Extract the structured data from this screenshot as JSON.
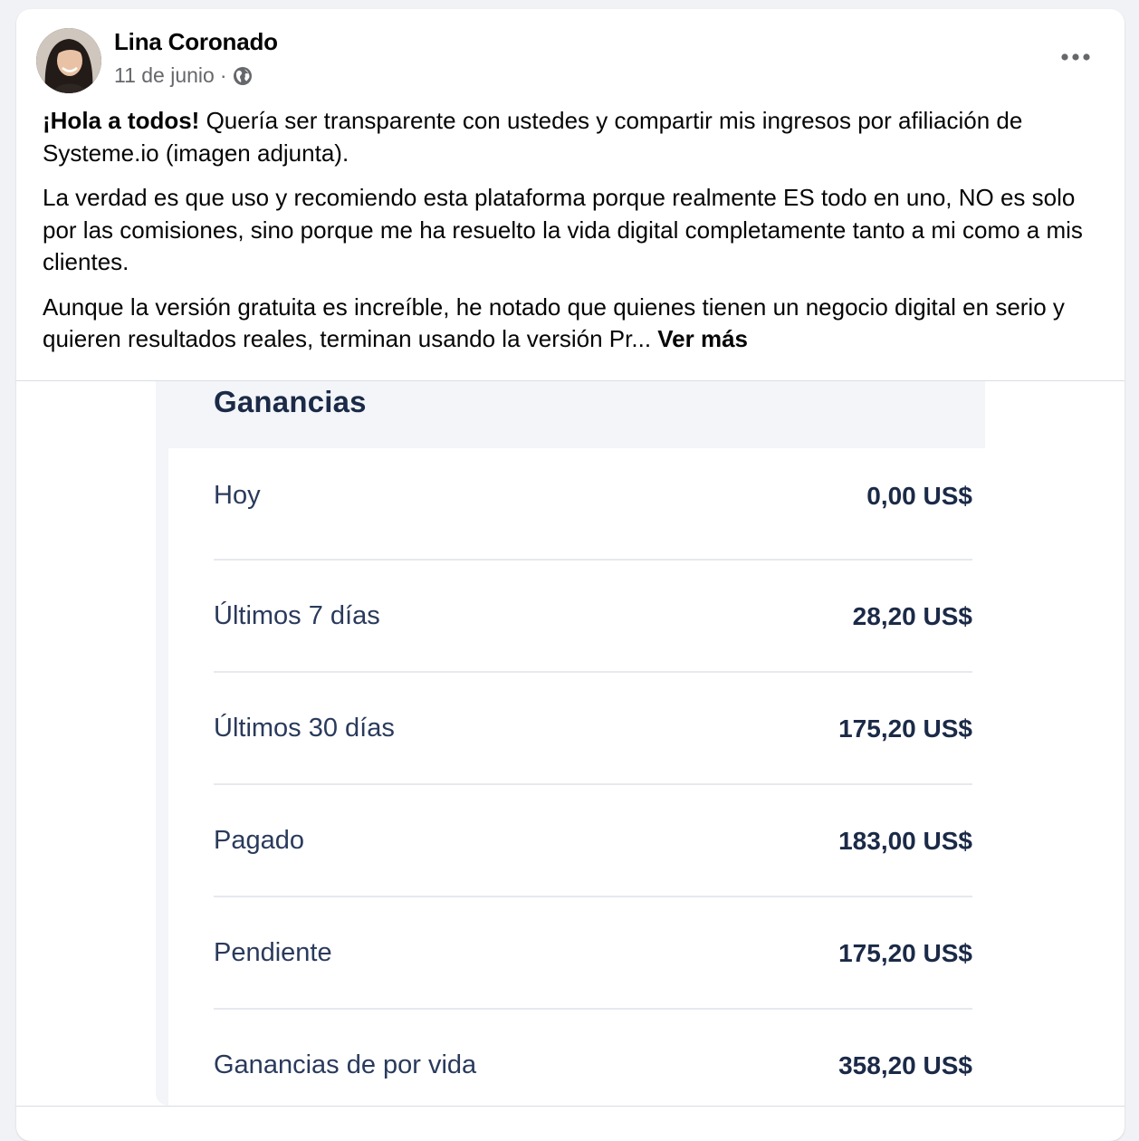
{
  "post": {
    "author": "Lina Coronado",
    "date": "11 de junio",
    "meta_separator": "·",
    "privacy_icon": "globe-icon",
    "more_icon": "more-options-icon",
    "greeting": "¡Hola a todos!",
    "paragraph1_rest": " Quería ser transparente con ustedes y compartir mis ingresos por afiliación de Systeme.io (imagen adjunta).",
    "paragraph2": "La verdad es que uso y recomiendo esta plataforma porque realmente ES todo en uno, NO es solo por las comisiones, sino porque me ha resuelto la vida digital completamente tanto a mi como a mis clientes.",
    "paragraph3": "Aunque la versión gratuita es increíble, he notado que quienes tienen un negocio digital en serio y quieren resultados reales, terminan usando la versión Pr... ",
    "see_more": "Ver más"
  },
  "earnings": {
    "title": "Ganancias",
    "rows": [
      {
        "label": "Hoy",
        "value": "0,00 US$"
      },
      {
        "label": "Últimos 7 días",
        "value": "28,20 US$"
      },
      {
        "label": "Últimos 30 días",
        "value": "175,20 US$"
      },
      {
        "label": "Pagado",
        "value": "183,00 US$"
      },
      {
        "label": "Pendiente",
        "value": "175,20 US$"
      },
      {
        "label": "Ganancias de por vida",
        "value": "358,20 US$"
      }
    ]
  },
  "colors": {
    "page_bg": "#f0f2f5",
    "text_primary": "#050505",
    "text_secondary": "#65676b",
    "earnings_title": "#1b2a47",
    "earnings_label": "#2a3a5c",
    "earnings_header_bg": "#f3f5f9"
  }
}
